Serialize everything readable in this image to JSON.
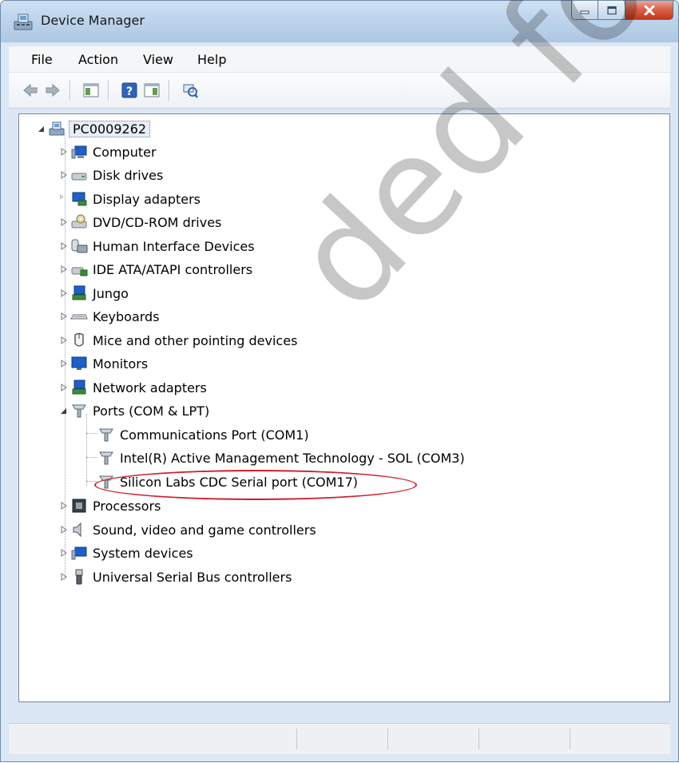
{
  "window": {
    "title": "Device Manager"
  },
  "menu": [
    {
      "label": "File"
    },
    {
      "label": "Action"
    },
    {
      "label": "View"
    },
    {
      "label": "Help"
    }
  ],
  "toolbar": [
    {
      "icon": "back-arrow-icon"
    },
    {
      "icon": "forward-arrow-icon"
    },
    {
      "icon": "show-hide-console-tree-icon"
    },
    {
      "icon": "help-icon"
    },
    {
      "icon": "show-action-pane-icon"
    },
    {
      "icon": "scan-hardware-changes-icon"
    }
  ],
  "tree": {
    "root": {
      "label": "PC0009262",
      "expanded": true
    },
    "categories": [
      {
        "label": "Computer",
        "icon": "computer-icon",
        "expanded": false
      },
      {
        "label": "Disk drives",
        "icon": "disk-drive-icon",
        "expanded": false
      },
      {
        "label": "Display adapters",
        "icon": "display-adapter-icon",
        "expanded": false
      },
      {
        "label": "DVD/CD-ROM drives",
        "icon": "dvd-drive-icon",
        "expanded": false
      },
      {
        "label": "Human Interface Devices",
        "icon": "hid-icon",
        "expanded": false
      },
      {
        "label": "IDE ATA/ATAPI controllers",
        "icon": "ide-controller-icon",
        "expanded": false
      },
      {
        "label": "Jungo",
        "icon": "jungo-icon",
        "expanded": false
      },
      {
        "label": "Keyboards",
        "icon": "keyboard-icon",
        "expanded": false
      },
      {
        "label": "Mice and other pointing devices",
        "icon": "mouse-icon",
        "expanded": false
      },
      {
        "label": "Monitors",
        "icon": "monitor-icon",
        "expanded": false
      },
      {
        "label": "Network adapters",
        "icon": "network-adapter-icon",
        "expanded": false
      },
      {
        "label": "Ports (COM & LPT)",
        "icon": "port-icon",
        "expanded": true
      },
      {
        "label": "Processors",
        "icon": "processor-icon",
        "expanded": false
      },
      {
        "label": "Sound, video and game controllers",
        "icon": "sound-icon",
        "expanded": false
      },
      {
        "label": "System devices",
        "icon": "system-devices-icon",
        "expanded": false
      },
      {
        "label": "Universal Serial Bus controllers",
        "icon": "usb-icon",
        "expanded": false
      }
    ],
    "ports_children": [
      {
        "label": "Communications Port (COM1)",
        "icon": "port-icon"
      },
      {
        "label": "Intel(R) Active Management Technology - SOL (COM3)",
        "icon": "port-icon"
      },
      {
        "label": "Silicon Labs CDC Serial port (COM17)",
        "icon": "port-icon",
        "highlighted": true
      }
    ]
  },
  "annotation": {
    "highlight_color": "#d0202a"
  },
  "watermark": {
    "text": "ded for New R"
  }
}
